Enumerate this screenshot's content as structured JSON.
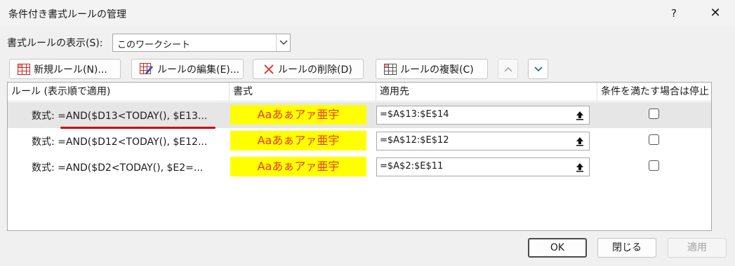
{
  "window": {
    "title": "条件付き書式ルールの管理",
    "help": "?",
    "close": "✕"
  },
  "show_rules": {
    "label": "書式ルールの表示(S):",
    "value": "このワークシート"
  },
  "toolbar": {
    "new_rule": "新規ルール(N)...",
    "edit_rule": "ルールの編集(E)...",
    "delete_rule": "ルールの削除(D)",
    "duplicate_rule": "ルールの複製(C)"
  },
  "table": {
    "headers": [
      "ルール (表示順で適用)",
      "書式",
      "適用先",
      "条件を満たす場合は停止"
    ],
    "rows": [
      {
        "rule": "数式: =AND($D13<TODAY(), $E13...",
        "format_preview": "Aaあぁアァ亜宇",
        "applies_to": "=$A$13:$E$14",
        "stop": false,
        "selected": true
      },
      {
        "rule": "数式: =AND($D12<TODAY(), $E12...",
        "format_preview": "Aaあぁアァ亜宇",
        "applies_to": "=$A$12:$E$12",
        "stop": false,
        "selected": false
      },
      {
        "rule": "数式: =AND($D2<TODAY(), $E2=...",
        "format_preview": "Aaあぁアァ亜宇",
        "applies_to": "=$A$2:$E$11",
        "stop": false,
        "selected": false
      }
    ]
  },
  "footer": {
    "ok": "OK",
    "close": "閉じる",
    "apply": "適用"
  },
  "colors": {
    "format_fill": "#ffff00",
    "format_text": "#e53935",
    "annotation_underline": "#d00000",
    "selected_row": "#e6e6e6"
  }
}
